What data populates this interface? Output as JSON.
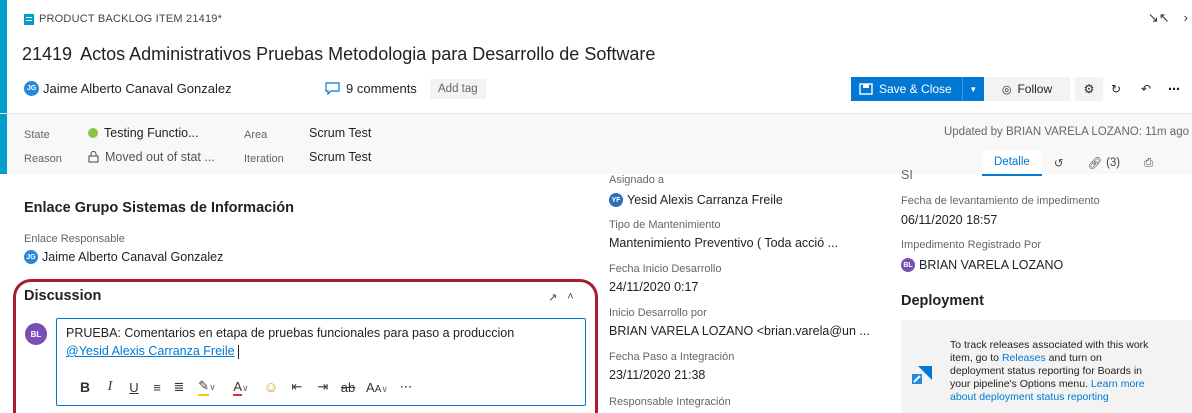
{
  "header": {
    "type_label": "PRODUCT BACKLOG ITEM 21419*",
    "id": "21419",
    "title": "Actos Administrativos Pruebas Metodologia para Desarrollo de Software",
    "assigned_initials": "JG",
    "assigned_to": "Jaime Alberto Canaval Gonzalez",
    "comments": "9 comments",
    "add_tag": "Add tag"
  },
  "toolbar": {
    "save_label": "Save & Close",
    "follow_label": "Follow"
  },
  "fields": {
    "state_label": "State",
    "state_value": "Testing Functio...",
    "reason_label": "Reason",
    "reason_value": "Moved out of stat ...",
    "area_label": "Area",
    "area_value": "Scrum Test",
    "iteration_label": "Iteration",
    "iteration_value": "Scrum Test",
    "updated": "Updated by BRIAN VARELA LOZANO: 11m ago"
  },
  "tabs": {
    "details": "Detalle",
    "links_count": "(3)"
  },
  "left": {
    "section_title": "Enlace Grupo Sistemas de Información",
    "resp_label": "Enlace Responsable",
    "resp_initials": "JG",
    "resp_value": "Jaime Alberto Canaval Gonzalez"
  },
  "discussion": {
    "title": "Discussion",
    "user_initials": "BL",
    "comment_text": "PRUEBA: Comentarios en etapa de pruebas funcionales para paso a produccion",
    "mention": "@Yesid Alexis Carranza Freile"
  },
  "middle": {
    "asignado_label": "Asignado a",
    "asignado_initials": "YF",
    "asignado_value": "Yesid Alexis Carranza Freile",
    "tipo_label": "Tipo de Mantenimiento",
    "tipo_value": "Mantenimiento Preventivo ( Toda acció ...",
    "fecha_inicio_label": "Fecha Inicio Desarrollo",
    "fecha_inicio_value": "24/11/2020 0:17",
    "inicio_por_label": "Inicio Desarrollo por",
    "inicio_por_value": "BRIAN VARELA LOZANO <brian.varela@un ...",
    "fecha_paso_label": "Fecha Paso a Integración",
    "fecha_paso_value": "23/11/2020 21:38",
    "resp_integ_label": "Responsable Integración"
  },
  "right": {
    "partial_value": "SI",
    "fecha_lev_label": "Fecha de levantamiento de impedimento",
    "fecha_lev_value": "06/11/2020 18:57",
    "imped_label": "Impedimento Registrado Por",
    "imped_initials": "BL",
    "imped_value": "BRIAN VARELA LOZANO",
    "deployment_title": "Deployment",
    "deploy_text_1": "To track releases associated with this work item, go to",
    "deploy_link_1": "Releases",
    "deploy_text_2": "and turn on deployment status reporting for Boards in your pipeline's Options menu.",
    "deploy_link_2": "Learn more about deployment status reporting"
  },
  "colors": {
    "accent": "#009ccc",
    "primary": "#0078d4",
    "state_green": "#8bc34a",
    "highlight_red": "#a81c2b",
    "avatar_jg": "#2b88d8",
    "avatar_bl": "#7a4fb5",
    "avatar_yf": "#2b6fb6"
  }
}
